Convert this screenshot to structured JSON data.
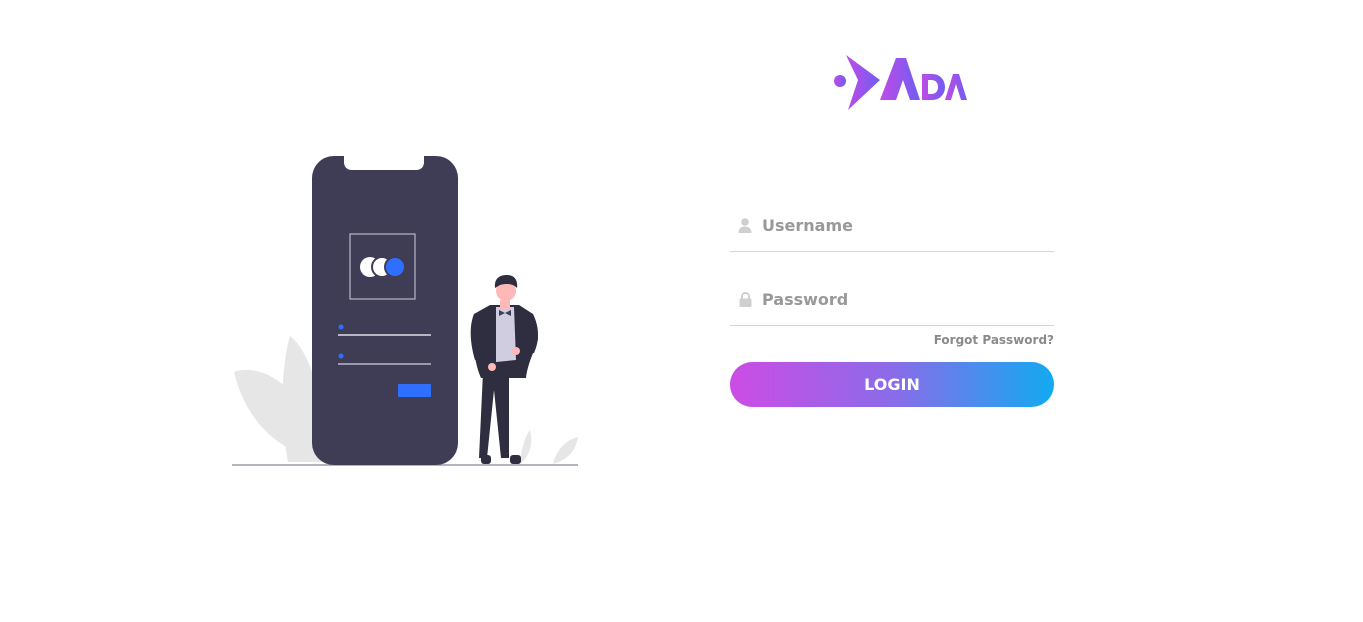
{
  "brand": {
    "name": "ADA",
    "gradient_start": "#b94be8",
    "gradient_end": "#7a5cf0"
  },
  "illustration": {
    "phone_color": "#3f3d56",
    "accent_color": "#2f6fff",
    "leaf_color": "#e6e6e6"
  },
  "login_form": {
    "username": {
      "placeholder": "Username",
      "value": "",
      "icon": "user-icon"
    },
    "password": {
      "placeholder": "Password",
      "value": "",
      "icon": "lock-icon"
    },
    "forgot_password_label": "Forgot Password?",
    "login_label": "LOGIN",
    "button_gradient": [
      "#cc4ce6",
      "#12aaf0"
    ]
  }
}
